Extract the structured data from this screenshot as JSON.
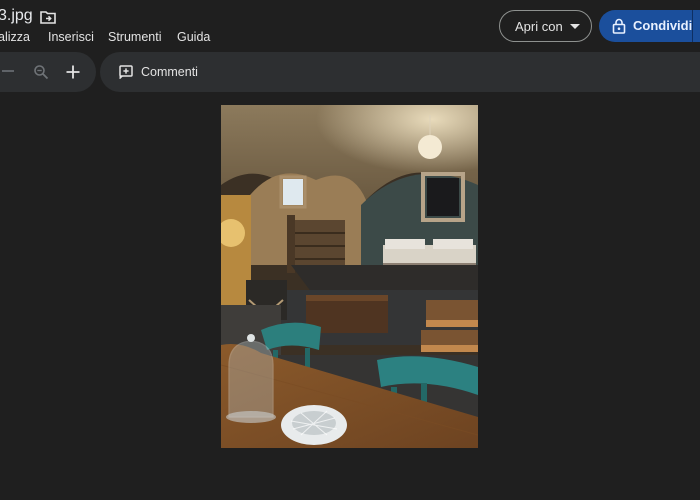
{
  "document": {
    "title": "3.jpg"
  },
  "menu": {
    "items": [
      "alizza",
      "Inserisci",
      "Strumenti",
      "Guida"
    ]
  },
  "actions": {
    "open_with_label": "Apri con",
    "share_label": "Condividi"
  },
  "toolbar": {
    "comments_label": "Commenti"
  },
  "icons": {
    "folder": "folder-move-icon",
    "zoom_out": "minus-icon",
    "zoom_search": "magnifier-icon",
    "zoom_in": "plus-icon",
    "comments": "add-comment-icon",
    "share": "lock-icon",
    "open_with_caret": "caret-down-icon"
  },
  "colors": {
    "background": "#1f1f1f",
    "toolbar": "#2d2f31",
    "share_button": "#1b4f9c",
    "text": "#e3e3e3"
  },
  "preview": {
    "subject": "photo-of-vaulted-stone-room-with-bed-and-table"
  }
}
